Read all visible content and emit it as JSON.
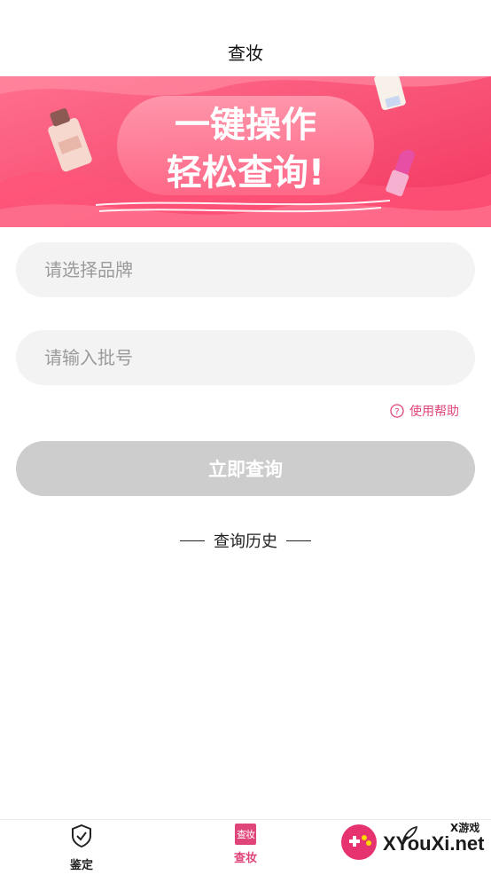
{
  "header": {
    "title": "查妆"
  },
  "banner": {
    "line1": "一键操作",
    "line2": "轻松查询!",
    "colors": {
      "primary": "#f2436a",
      "light": "#ff8aa0",
      "dark": "#e23057"
    }
  },
  "form": {
    "brand_placeholder": "请选择品牌",
    "batch_placeholder": "请输入批号",
    "help_label": "使用帮助",
    "submit_label": "立即查询"
  },
  "history": {
    "title": "查询历史"
  },
  "tabbar": {
    "items": [
      {
        "label": "鉴定",
        "icon": "shield-check-icon"
      },
      {
        "label": "查妆",
        "icon": "chazhuang-icon",
        "icon_text": "查妆",
        "active": true
      },
      {
        "label": "",
        "icon": "feather-icon"
      }
    ],
    "accent": "#e0457a"
  },
  "watermark": {
    "text": "XYouXi.net",
    "small": "X游戏"
  }
}
